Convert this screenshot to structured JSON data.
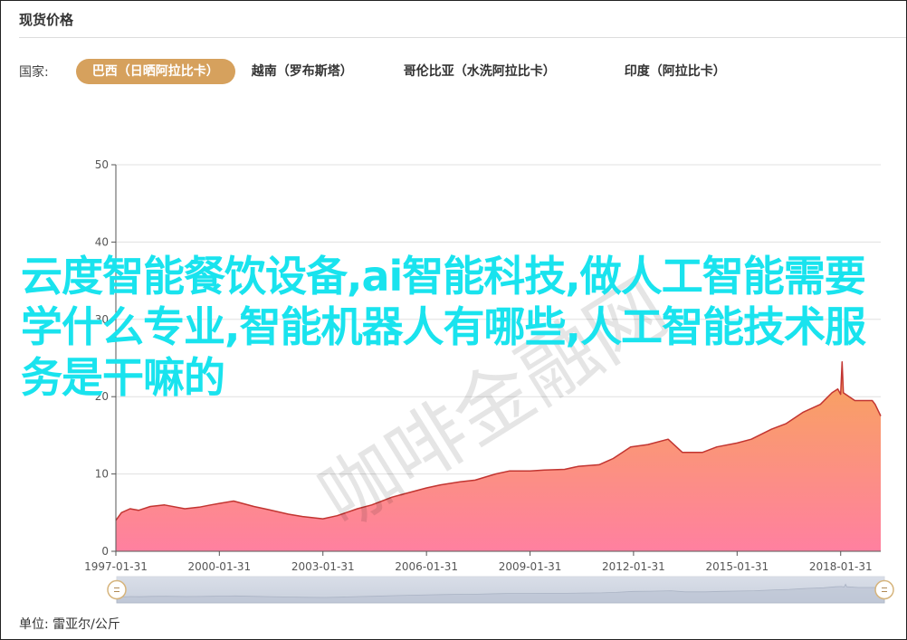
{
  "header": {
    "title": "现货价格"
  },
  "country_filter": {
    "label": "国家:",
    "tabs": [
      {
        "label": "巴西（日晒阿拉比卡）",
        "active": true
      },
      {
        "label": "越南（罗布斯塔）",
        "active": false
      },
      {
        "label": "哥伦比亚（水洗阿拉比卡）",
        "active": false
      },
      {
        "label": "印度（阿拉比卡）",
        "active": false
      }
    ]
  },
  "overlay_text": "云度智能餐饮设备,ai智能科技,做人工智能需要学什么专业,智能机器人有哪些,人工智能技术服务是干嘛的",
  "watermark": "咖啡金融网",
  "unit": "单位: 雷亚尔/公斤",
  "colors": {
    "accent": "#d6a15d",
    "line": "#c23531",
    "area_top": "#f7a55a",
    "area_bottom": "#ff80a0",
    "overlay": "#19e3ee"
  },
  "chart_data": {
    "type": "area",
    "title": "",
    "xlabel": "",
    "ylabel": "",
    "ylim": [
      0,
      50
    ],
    "yticks": [
      0,
      10,
      20,
      30,
      40,
      50
    ],
    "xlim": [
      "1997-01-31",
      "2019-03-31"
    ],
    "xtick_labels": [
      "1997-01-31",
      "2000-01-31",
      "2003-01-31",
      "2006-01-31",
      "2009-01-31",
      "2012-01-31",
      "2015-01-31",
      "2018-01-31"
    ],
    "grid": true,
    "series": [
      {
        "x": [
          "1997-01-31",
          "1997-03-31",
          "1997-06-30",
          "1997-09-30",
          "1998-01-31",
          "1998-06-30",
          "1999-01-31",
          "1999-06-30",
          "1999-10-31",
          "2000-01-31",
          "2000-06-30",
          "2001-01-31",
          "2001-06-30",
          "2002-01-31",
          "2002-06-30",
          "2003-01-31",
          "2003-06-30",
          "2004-01-31",
          "2004-06-30",
          "2005-01-31",
          "2005-06-30",
          "2006-01-31",
          "2006-06-30",
          "2007-01-31",
          "2007-06-30",
          "2008-01-31",
          "2008-06-30",
          "2009-01-31",
          "2009-06-30",
          "2010-01-31",
          "2010-06-30",
          "2011-01-31",
          "2011-06-30",
          "2011-12-31",
          "2012-06-30",
          "2013-01-31",
          "2013-06-30",
          "2014-01-31",
          "2014-06-30",
          "2015-01-31",
          "2015-06-30",
          "2016-01-31",
          "2016-06-30",
          "2016-12-31",
          "2017-06-30",
          "2017-10-31",
          "2017-12-31",
          "2018-01-31",
          "2018-02-15",
          "2018-02-28",
          "2018-06-30",
          "2018-12-31",
          "2019-01-31",
          "2019-03-31"
        ],
        "values": [
          4.0,
          5.0,
          5.5,
          5.3,
          5.8,
          6.0,
          5.5,
          5.7,
          6.0,
          6.2,
          6.5,
          5.8,
          5.4,
          4.8,
          4.5,
          4.2,
          4.6,
          5.5,
          6.0,
          7.0,
          7.5,
          8.2,
          8.6,
          9.0,
          9.2,
          10.0,
          10.4,
          10.4,
          10.5,
          10.6,
          11.0,
          11.2,
          12.0,
          13.5,
          13.8,
          14.5,
          12.8,
          12.8,
          13.5,
          14.0,
          14.5,
          15.8,
          16.5,
          18.0,
          19.0,
          20.5,
          21.0,
          20.3,
          24.5,
          20.5,
          19.5,
          19.5,
          19.0,
          17.5
        ]
      }
    ]
  }
}
